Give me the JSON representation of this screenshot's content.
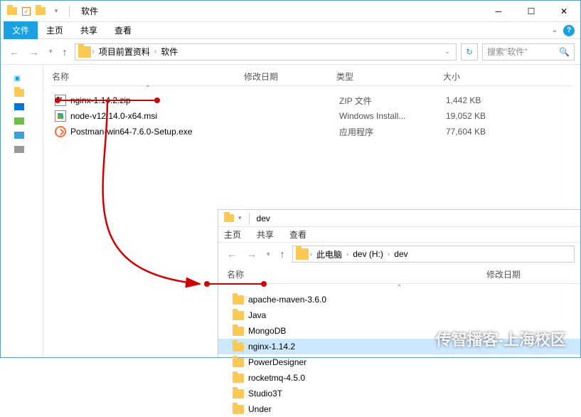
{
  "window1": {
    "title": "软件",
    "tabs": {
      "file": "文件",
      "home": "主页",
      "share": "共享",
      "view": "查看"
    },
    "breadcrumb": [
      "项目前置资料",
      "软件"
    ],
    "search_placeholder": "搜索\"软件\"",
    "columns": {
      "name": "名称",
      "date": "修改日期",
      "type": "类型",
      "size": "大小"
    },
    "files": [
      {
        "name": "nginx-1.14.2.zip",
        "type": "ZIP 文件",
        "size": "1,442 KB",
        "icon": "zip"
      },
      {
        "name": "node-v12.14.0-x64.msi",
        "type": "Windows Install...",
        "size": "19,052 KB",
        "icon": "msi"
      },
      {
        "name": "Postman-win64-7.6.0-Setup.exe",
        "type": "应用程序",
        "size": "77,604 KB",
        "icon": "exe"
      }
    ]
  },
  "window2": {
    "title": "dev",
    "tabs": {
      "home": "主页",
      "share": "共享",
      "view": "查看"
    },
    "breadcrumb": [
      "此电脑",
      "dev (H:)",
      "dev"
    ],
    "columns": {
      "name": "名称",
      "date": "修改日期"
    },
    "folders": [
      "apache-maven-3.6.0",
      "Java",
      "MongoDB",
      "nginx-1.14.2",
      "PowerDesigner",
      "rocketmq-4.5.0",
      "Studio3T",
      "Under"
    ],
    "selected_index": 3
  },
  "watermark": "传智播客-上海校区"
}
